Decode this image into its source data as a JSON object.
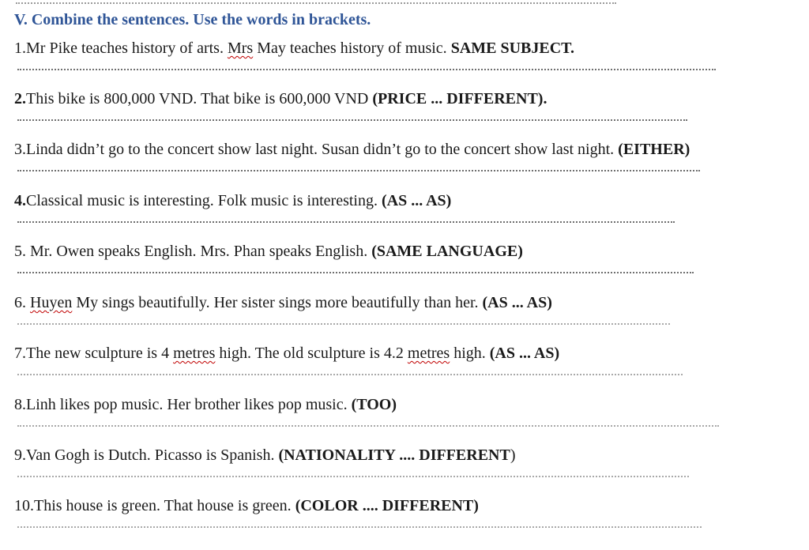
{
  "title": "V. Combine the sentences. Use the words in brackets.",
  "items": [
    {
      "segments": [
        {
          "t": "1.Mr Pike teaches history of arts. ",
          "s": "n"
        },
        {
          "t": "Mrs",
          "s": "sq"
        },
        {
          "t": " May teaches history of music. ",
          "s": "n"
        },
        {
          "t": "SAME SUBJECT.",
          "s": "b"
        }
      ]
    },
    {
      "segments": [
        {
          "t": "2.",
          "s": "b"
        },
        {
          "t": "This bike is 800,000 VND. That bike is 600,000 VND ",
          "s": "n"
        },
        {
          "t": "(PRICE ... DIFFERENT).",
          "s": "b"
        }
      ]
    },
    {
      "segments": [
        {
          "t": "3.Linda didn’t go to the concert show last night. Susan didn’t go to the concert show last night. ",
          "s": "n"
        },
        {
          "t": "(EITHER)",
          "s": "b"
        }
      ]
    },
    {
      "segments": [
        {
          "t": "4.",
          "s": "b"
        },
        {
          "t": "Classical music is interesting. Folk music is interesting. ",
          "s": "n"
        },
        {
          "t": "(AS ... AS)",
          "s": "b"
        }
      ]
    },
    {
      "segments": [
        {
          "t": "5. Mr. Owen speaks English. Mrs. Phan speaks English. ",
          "s": "n"
        },
        {
          "t": "(SAME LANGUAGE)",
          "s": "b"
        }
      ]
    },
    {
      "segments": [
        {
          "t": "6. ",
          "s": "n"
        },
        {
          "t": "Huyen",
          "s": "sq"
        },
        {
          "t": " My sings beautifully. Her sister sings more beautifully than her. ",
          "s": "n"
        },
        {
          "t": "(AS ... AS)",
          "s": "b"
        }
      ]
    },
    {
      "segments": [
        {
          "t": " 7.The new sculpture is 4 ",
          "s": "n"
        },
        {
          "t": "metres",
          "s": "sq"
        },
        {
          "t": " high. The old sculpture is 4.2 ",
          "s": "n"
        },
        {
          "t": "metres",
          "s": "sq"
        },
        {
          "t": " high. ",
          "s": "n"
        },
        {
          "t": "(AS ... AS)",
          "s": "b"
        }
      ]
    },
    {
      "segments": [
        {
          "t": "8.Linh likes pop music. Her brother likes pop music. ",
          "s": "n"
        },
        {
          "t": "(TOO)",
          "s": "b"
        }
      ]
    },
    {
      "segments": [
        {
          "t": "9.Van Gogh is Dutch. Picasso is Spanish. ",
          "s": "n"
        },
        {
          "t": "(NATIONALITY .... DIFFERENT",
          "s": "b"
        },
        {
          "t": ")",
          "s": "n"
        }
      ]
    },
    {
      "segments": [
        {
          "t": "10.This house is green. That house is green. ",
          "s": "n"
        },
        {
          "t": "(COLOR .... DIFFERENT)",
          "s": "b"
        }
      ]
    }
  ]
}
